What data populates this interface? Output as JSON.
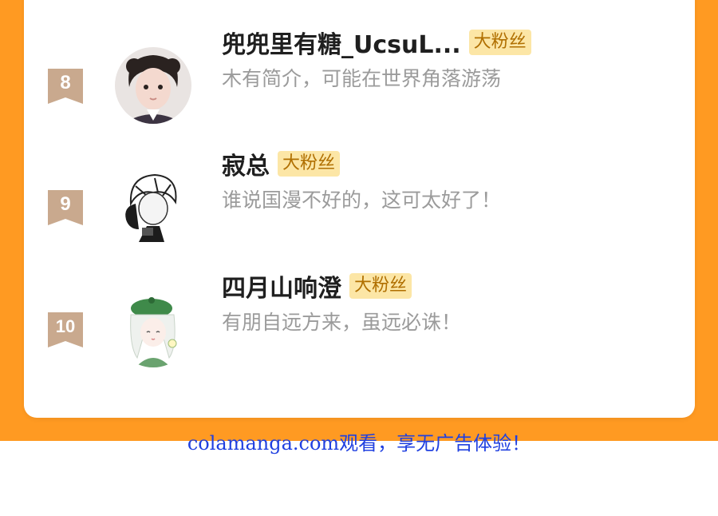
{
  "colors": {
    "background": "#ff9a22",
    "card": "#ffffff",
    "badge_bg": "#fce6a6",
    "badge_text": "#b06f00",
    "rank_badge": "#c9a98e",
    "link": "#2040e0"
  },
  "rows": [
    {
      "rank": "8",
      "name": "兜兜里有糖_UcsuL...",
      "badge": "大粉丝",
      "bio": "木有简介，可能在世界角落游荡",
      "avatar": "girl-photo-avatar"
    },
    {
      "rank": "9",
      "name": "寂总",
      "badge": "大粉丝",
      "bio": "谁说国漫不好的，这可太好了！",
      "avatar": "sketch-boy-avatar"
    },
    {
      "rank": "10",
      "name": "四月山响澄",
      "badge": "大粉丝",
      "bio": "有朋自远方来，虽远必诛！",
      "avatar": "green-hat-girl-avatar"
    }
  ],
  "footer": {
    "text": "colamanga.com观看，享无广告体验！"
  }
}
